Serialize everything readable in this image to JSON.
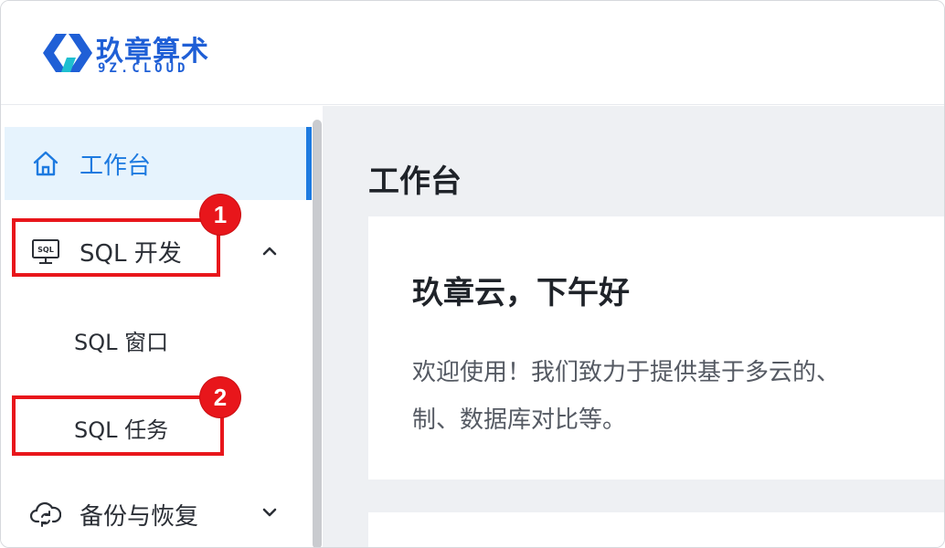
{
  "brand": {
    "name_cn": "玖章算术",
    "name_en": "9Z.CLOUD",
    "colors": {
      "primary": "#1f5fd6",
      "accent": "#1fbfd0"
    }
  },
  "sidebar": {
    "items": [
      {
        "label": "工作台",
        "icon": "home-icon",
        "active": true
      },
      {
        "label": "SQL 开发",
        "icon": "sql-monitor-icon",
        "expanded": true,
        "children": [
          {
            "label": "SQL 窗口"
          },
          {
            "label": "SQL 任务"
          }
        ]
      },
      {
        "label": "备份与恢复",
        "icon": "cloud-sync-icon",
        "expanded": false
      }
    ],
    "active_color": "#1d7ae0"
  },
  "annotations": [
    {
      "number": "1",
      "target": "SQL 开发"
    },
    {
      "number": "2",
      "target": "SQL 任务"
    }
  ],
  "main": {
    "title": "工作台",
    "welcome": {
      "greeting": "玖章云，下午好",
      "line1": "欢迎使用！我们致力于提供基于多云的、",
      "line2": "制、数据库对比等。"
    }
  }
}
